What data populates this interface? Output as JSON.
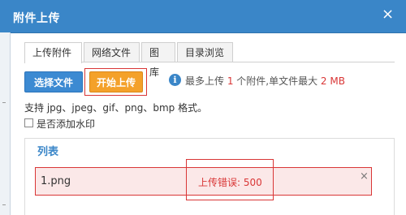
{
  "dialog": {
    "title": "附件上传",
    "close_glyph": "×"
  },
  "tabs": [
    {
      "label": "上传附件"
    },
    {
      "label": "网络文件"
    },
    {
      "label": "图库"
    },
    {
      "label": "目录浏览"
    }
  ],
  "toolbar": {
    "select_label": "选择文件",
    "start_label": "开始上传"
  },
  "info": {
    "icon_glyph": "i",
    "prefix": "最多上传 ",
    "max_files": "1",
    "middle": " 个附件,单文件最大 ",
    "max_size": "2 MB"
  },
  "formats_text": "支持 jpg、jpeg、gif、png、bmp 格式。",
  "watermark": {
    "label": "是否添加水印",
    "checked": false
  },
  "list": {
    "title": "列表",
    "files": [
      {
        "name": "1.png",
        "status": "上传错误: 500",
        "remove_glyph": "×"
      }
    ]
  },
  "colors": {
    "titlebar": "#3a86c8",
    "select_button": "#3c8ad2",
    "start_button": "#f4a12a",
    "error": "#d93636",
    "error_row_bg": "#fbe8e8"
  }
}
